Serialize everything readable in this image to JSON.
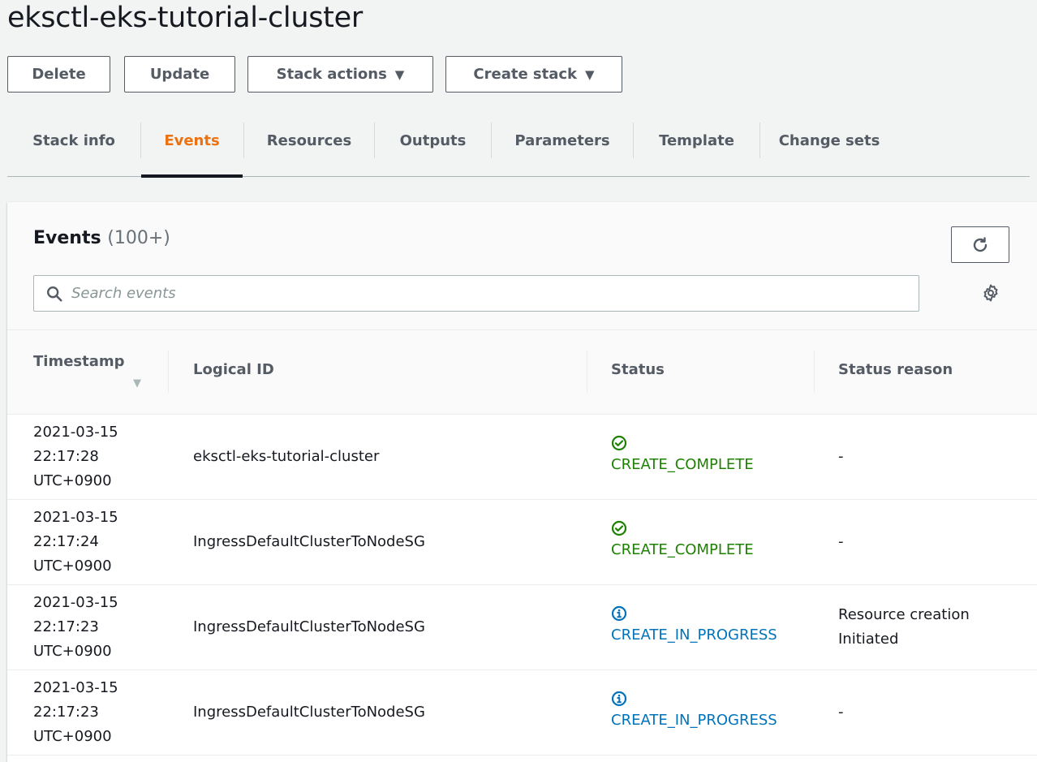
{
  "title": "eksctl-eks-tutorial-cluster",
  "actions": {
    "delete": "Delete",
    "update": "Update",
    "stack_actions": "Stack actions",
    "create_stack": "Create stack"
  },
  "tabs": [
    "Stack info",
    "Events",
    "Resources",
    "Outputs",
    "Parameters",
    "Template",
    "Change sets"
  ],
  "active_tab": "Events",
  "events": {
    "title": "Events",
    "count": "(100+)",
    "search_placeholder": "Search events",
    "columns": [
      "Timestamp",
      "Logical ID",
      "Status",
      "Status reason"
    ],
    "rows": [
      {
        "date": "2021-03-15",
        "time": "22:17:28",
        "tz": "UTC+0900",
        "logical_id": "eksctl-eks-tutorial-cluster",
        "status": "CREATE_COMPLETE",
        "status_kind": "complete",
        "reason_line1": "-",
        "reason_line2": ""
      },
      {
        "date": "2021-03-15",
        "time": "22:17:24",
        "tz": "UTC+0900",
        "logical_id": "IngressDefaultClusterToNodeSG",
        "status": "CREATE_COMPLETE",
        "status_kind": "complete",
        "reason_line1": "-",
        "reason_line2": ""
      },
      {
        "date": "2021-03-15",
        "time": "22:17:23",
        "tz": "UTC+0900",
        "logical_id": "IngressDefaultClusterToNodeSG",
        "status": "CREATE_IN_PROGRESS",
        "status_kind": "in-progress",
        "reason_line1": "Resource creation",
        "reason_line2": "Initiated"
      },
      {
        "date": "2021-03-15",
        "time": "22:17:23",
        "tz": "UTC+0900",
        "logical_id": "IngressDefaultClusterToNodeSG",
        "status": "CREATE_IN_PROGRESS",
        "status_kind": "in-progress",
        "reason_line1": "-",
        "reason_line2": ""
      }
    ]
  },
  "colors": {
    "accent": "#ec7211",
    "complete": "#1d8102",
    "in_progress": "#0073bb",
    "text": "#16191f",
    "muted": "#545b64"
  },
  "icons": {
    "complete": "check-circle-icon",
    "in_progress": "info-circle-icon",
    "refresh": "refresh-icon",
    "search": "search-icon",
    "settings": "gear-icon",
    "caret": "caret-down-icon"
  }
}
